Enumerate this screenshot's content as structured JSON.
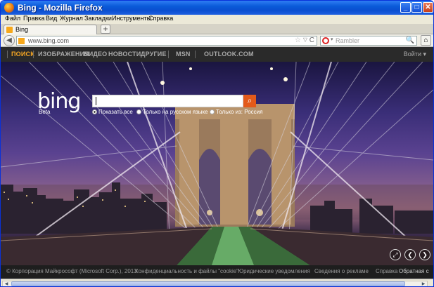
{
  "window": {
    "title": "Bing - Mozilla Firefox",
    "minimize": "_",
    "maximize": "□",
    "close": "✕"
  },
  "menu": [
    "Файл",
    "Правка",
    "Вид",
    "Журнал",
    "Закладки",
    "Инструменты",
    "Справка"
  ],
  "tabs": [
    {
      "label": "Bing"
    }
  ],
  "new_tab": "+",
  "nav": {
    "back": "◀",
    "url": "www.bing.com",
    "star": "☆",
    "dropdown": "▽",
    "reload": "C",
    "search_placeholder": "Rambler",
    "search_caret": "▾",
    "search_icon": "🔍",
    "home_icon": "⌂"
  },
  "bing_nav": {
    "items": [
      "ПОИСК",
      "ИЗОБРАЖЕНИЯ",
      "ВИДЕО",
      "НОВОСТИ",
      "ДРУГИЕ",
      "MSN",
      "OUTLOOK.COM"
    ],
    "login": "Войти ▾"
  },
  "hero": {
    "logo": "bing",
    "beta": "Beta",
    "search_value": "",
    "search_button": "⌕",
    "radios": [
      {
        "label": "Показать все",
        "checked": true
      },
      {
        "label": "Только на русском языке",
        "checked": false
      },
      {
        "label": "Только из: Россия",
        "checked": false
      }
    ],
    "controls": [
      "⤢",
      "❮",
      "❯"
    ]
  },
  "footer": {
    "items": [
      "© Корпорация Майкрософт (Microsoft Corp.), 2013",
      "Конфиденциальность и файлы \"cookie\"",
      "Юридические уведомления",
      "Сведения о рекламе",
      "Справка",
      "Обратная с"
    ]
  },
  "colors": {
    "accent": "#f5a623",
    "search_button": "#e35a1a",
    "titlebar": "#0a5ad8"
  }
}
